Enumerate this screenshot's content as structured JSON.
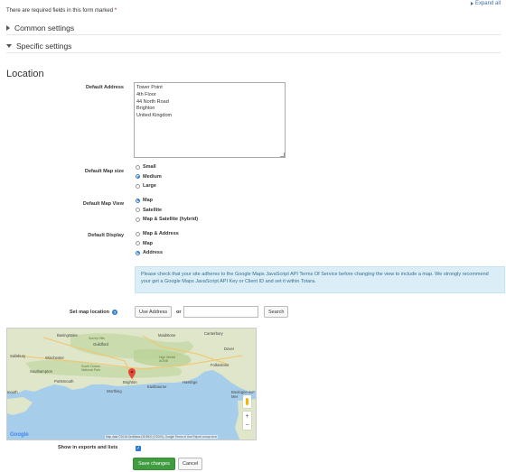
{
  "top": {
    "expand_all": "Expand all",
    "required_note": "There are required fields in this form marked",
    "required_star": "*"
  },
  "sections": {
    "common": "Common settings",
    "specific": "Specific settings"
  },
  "heading": "Location",
  "fields": {
    "default_address": {
      "label": "Default Address",
      "value": "Tower Point\n4th Floor\n44 North Road\nBrighton\nUnited Kingdom"
    },
    "map_size": {
      "label": "Default Map size",
      "options": [
        "Small",
        "Medium",
        "Large"
      ],
      "selected": "Medium"
    },
    "map_view": {
      "label": "Default Map View",
      "options": [
        "Map",
        "Satellite",
        "Map & Satellite (hybrid)"
      ],
      "selected": "Map"
    },
    "display": {
      "label": "Default Display",
      "options": [
        "Map & Address",
        "Map",
        "Address"
      ],
      "selected": "Address"
    }
  },
  "notice": "Please check that your site adheres to the Google Maps JavaScript API Terms Of Service before changing the view to include a map. We strongly recommend your get a Google Maps JavaScript API Key or Client ID and set it within Totara.",
  "map_location": {
    "label": "Set map location",
    "help_icon": "question-icon",
    "use_address": "Use Address",
    "or": "or",
    "search_value": "",
    "search_button": "Search"
  },
  "map": {
    "places": [
      "Basingstoke",
      "Guildford",
      "Surrey Hills",
      "Maidstone",
      "Canterbury",
      "Salisbury",
      "Winchester",
      "Dover",
      "High Weald AONB",
      "Folkestone",
      "Southampton",
      "South Downs National Park",
      "Portsmouth",
      "Brighton",
      "Hastings",
      "Eastbourne",
      "Worthing",
      "Boulogne-sur-Mer",
      "mouth"
    ],
    "copyright": "Map data ©2016 GeoBasis-DE/BKG (©2009), Google   Terms of Use   Report a map error",
    "google": "Google",
    "zoom_in": "+",
    "zoom_out": "−"
  },
  "export": {
    "label": "Show in exports and lists",
    "checked": true
  },
  "buttons": {
    "save": "Save changes",
    "cancel": "Cancel"
  },
  "colors": {
    "primary": "#3f9c3f",
    "link": "#3a6ea5",
    "required": "#d9534f",
    "notice_bg": "#dbeef7"
  }
}
